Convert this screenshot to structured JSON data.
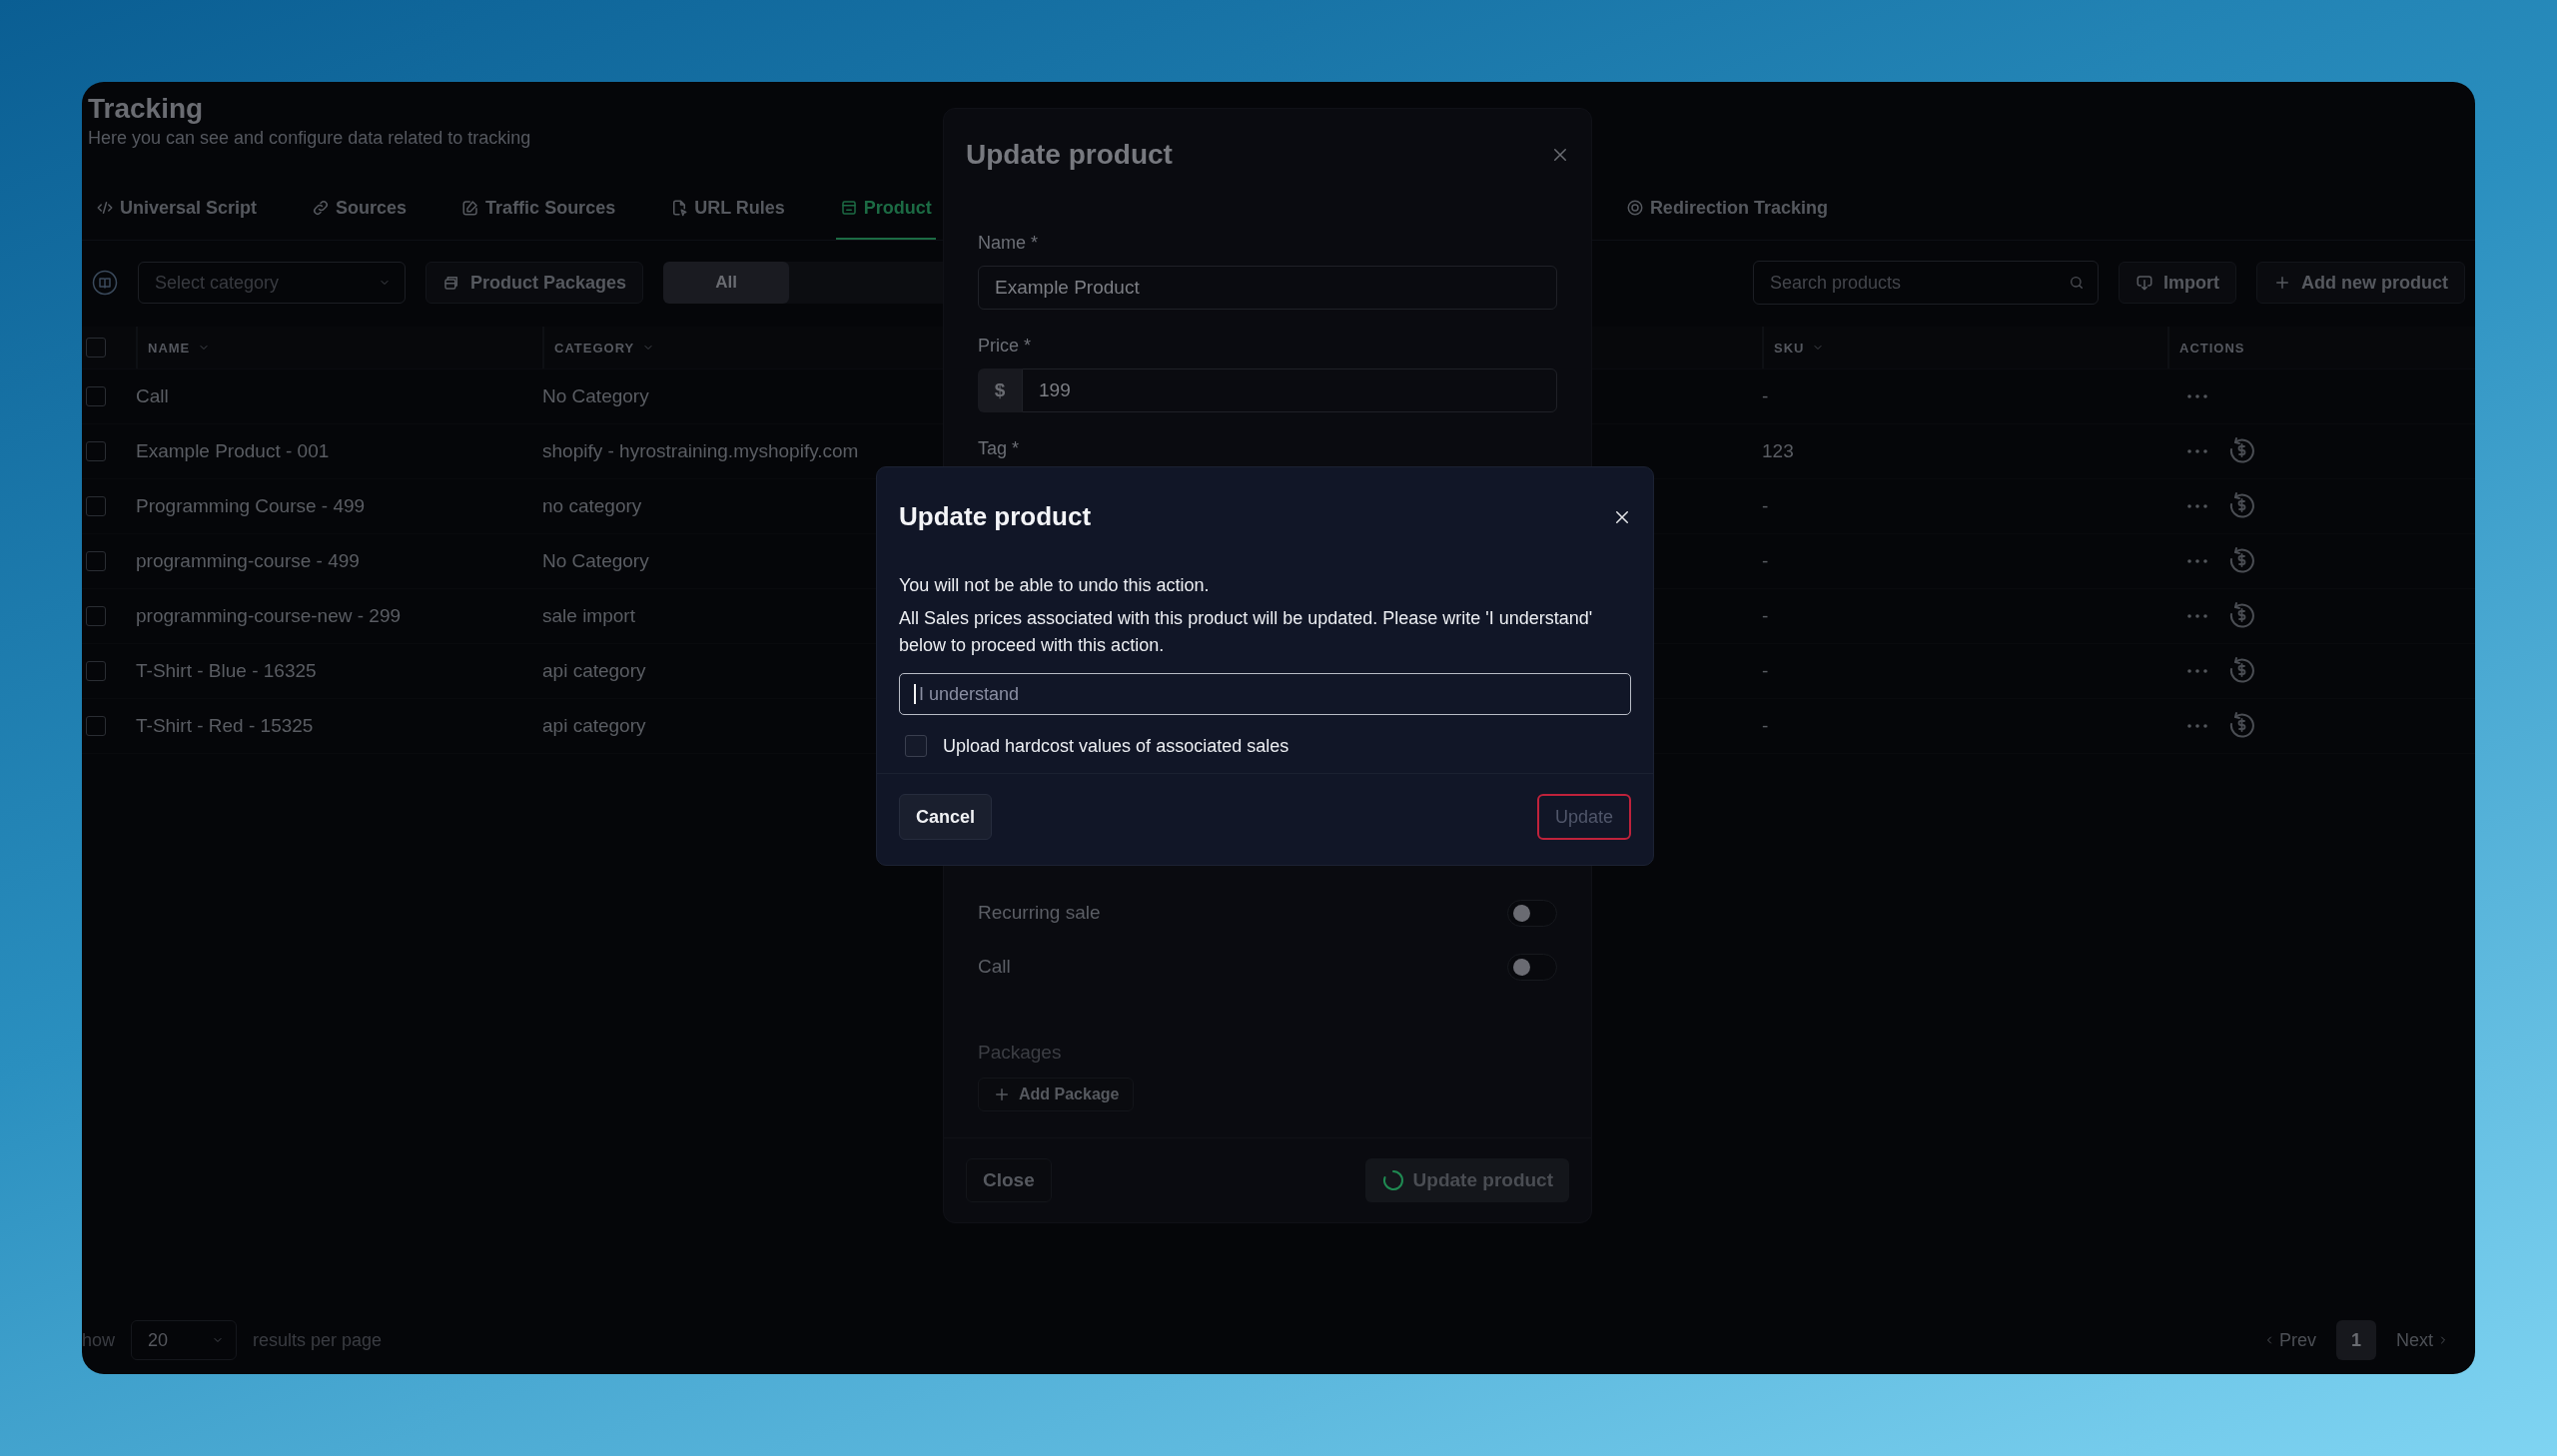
{
  "page": {
    "title": "Tracking",
    "subtitle": "Here you can see and configure data related to tracking"
  },
  "tabs": [
    {
      "label": "Universal Script",
      "selected": false
    },
    {
      "label": "Sources",
      "selected": false
    },
    {
      "label": "Traffic Sources",
      "selected": false
    },
    {
      "label": "URL Rules",
      "selected": false
    },
    {
      "label": "Product",
      "selected": true
    },
    {
      "label": "Redirection Tracking",
      "selected": false
    }
  ],
  "toolbar": {
    "category_select": {
      "placeholder": "Select category"
    },
    "packages_button": "Product Packages",
    "segments": [
      {
        "label": "All",
        "selected": true
      }
    ],
    "search": {
      "placeholder": "Search products"
    },
    "import_button": "Import",
    "add_button": "Add new product"
  },
  "table": {
    "select_all_checked": false,
    "columns": [
      {
        "label": "NAME",
        "sortable": true
      },
      {
        "label": "CATEGORY",
        "sortable": true
      },
      {
        "label": "SKU",
        "sortable": true
      },
      {
        "label": "ACTIONS",
        "sortable": false
      }
    ],
    "rows": [
      {
        "checked": false,
        "name": "Call",
        "category": "No Category",
        "sku": "-",
        "refund": false
      },
      {
        "checked": false,
        "name": "Example Product - 001",
        "category": "shopify - hyrostraining.myshopify.com",
        "sku": "123",
        "refund": true
      },
      {
        "checked": false,
        "name": "Programming Course - 499",
        "category": "no category",
        "sku": "-",
        "refund": true
      },
      {
        "checked": false,
        "name": "programming-course - 499",
        "category": "No Category",
        "sku": "-",
        "refund": true
      },
      {
        "checked": false,
        "name": "programming-course-new - 299",
        "category": "sale import",
        "sku": "-",
        "refund": true
      },
      {
        "checked": false,
        "name": "T-Shirt - Blue - 16325",
        "category": "api category",
        "sku": "-",
        "refund": true
      },
      {
        "checked": false,
        "name": "T-Shirt - Red - 15325",
        "category": "api category",
        "sku": "-",
        "refund": true
      }
    ]
  },
  "pagination": {
    "show_label": "how",
    "page_size": "20",
    "suffix": "results per page",
    "prev": "Prev",
    "pages": [
      {
        "label": "1",
        "selected": true
      }
    ],
    "next": "Next"
  },
  "product_modal": {
    "title": "Update product",
    "fields": [
      {
        "label": "Name *",
        "value": "Example Product"
      },
      {
        "label": "Price *",
        "prefix": "$",
        "value": "199"
      }
    ],
    "tag_label": "Tag *",
    "toggles": [
      {
        "label": "Recurring sale",
        "on": false
      },
      {
        "label": "Call",
        "on": false
      }
    ],
    "packages_label": "Packages",
    "add_package": "Add Package",
    "close": "Close",
    "submit": {
      "label": "Update product",
      "loading": true
    }
  },
  "confirm_dialog": {
    "title": "Update product",
    "lines": [
      "You will not be able to undo this action.",
      "All Sales prices associated with this product will be updated. Please write 'I understand' below to proceed with this action."
    ],
    "input": {
      "placeholder": "I understand",
      "focused": true
    },
    "checkbox": {
      "label": "Upload hardcost values of associated sales",
      "checked": false
    },
    "cancel": "Cancel",
    "confirm": {
      "label": "Update",
      "disabled": true
    }
  }
}
